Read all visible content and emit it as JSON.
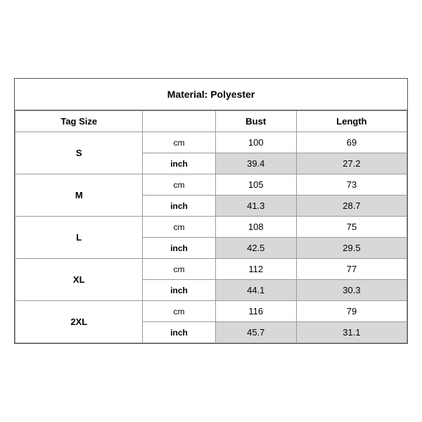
{
  "title": "Material: Polyester",
  "headers": {
    "tag_size": "Tag Size",
    "bust": "Bust",
    "length": "Length"
  },
  "sizes": [
    {
      "tag": "S",
      "cm_bust": "100",
      "cm_length": "69",
      "inch_bust": "39.4",
      "inch_length": "27.2"
    },
    {
      "tag": "M",
      "cm_bust": "105",
      "cm_length": "73",
      "inch_bust": "41.3",
      "inch_length": "28.7"
    },
    {
      "tag": "L",
      "cm_bust": "108",
      "cm_length": "75",
      "inch_bust": "42.5",
      "inch_length": "29.5"
    },
    {
      "tag": "XL",
      "cm_bust": "112",
      "cm_length": "77",
      "inch_bust": "44.1",
      "inch_length": "30.3"
    },
    {
      "tag": "2XL",
      "cm_bust": "116",
      "cm_length": "79",
      "inch_bust": "45.7",
      "inch_length": "31.1"
    }
  ],
  "units": {
    "cm": "cm",
    "inch": "inch"
  }
}
